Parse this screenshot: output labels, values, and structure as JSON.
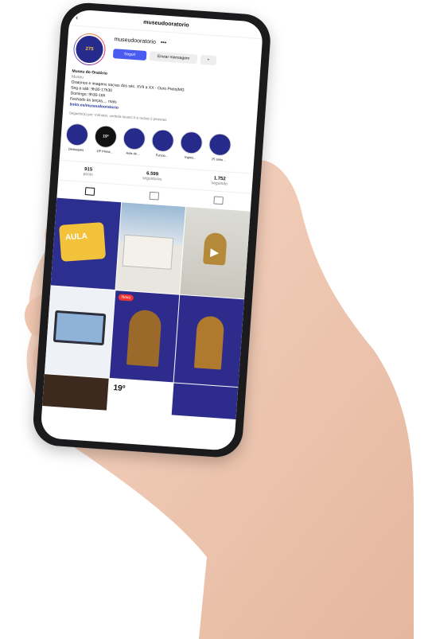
{
  "profile": {
    "username_header": "museudooratorio",
    "username": "museudooratorio",
    "more_icon": "ellipsis-icon",
    "avatar_text": "275",
    "follow_label": "Seguir",
    "message_label": "Enviar mensagem",
    "add_label": "+"
  },
  "bio": {
    "name": "Museu do Oratório",
    "category": "Museu",
    "line1": "Oratórios e imagens sacras dos séc. XVII a XX - Ouro Preto|MG",
    "line2": "Seg a sáb: 9h30-17h30",
    "line3": "Domingo: 9h30-16h",
    "line4": "Fechado às terças,... mais",
    "link": "linktr.ee/museudooratorio",
    "followed_by": "Seguido(a) por: mhhotel, verbeta.lucas2.0 e outras 5 pessoas"
  },
  "stories": [
    {
      "label": "Destaques",
      "badge": ""
    },
    {
      "label": "19º Prima...",
      "badge": "19º"
    },
    {
      "label": "Aula de ...",
      "badge": ""
    },
    {
      "label": "Funcio...",
      "badge": ""
    },
    {
      "label": "Ingres...",
      "badge": ""
    },
    {
      "label": "25 anos ...",
      "badge": ""
    }
  ],
  "stats": {
    "posts_value": "915",
    "posts_label": "posts",
    "followers_value": "6.599",
    "followers_label": "seguidores",
    "following_value": "1.752",
    "following_label": "seguindo"
  },
  "grid": {
    "post1_text": "AULA",
    "post5_badge": "Novo",
    "post8_text": "19º"
  },
  "colors": {
    "brand_blue": "#2c2f8f",
    "follow_button": "#4a5cf0"
  }
}
